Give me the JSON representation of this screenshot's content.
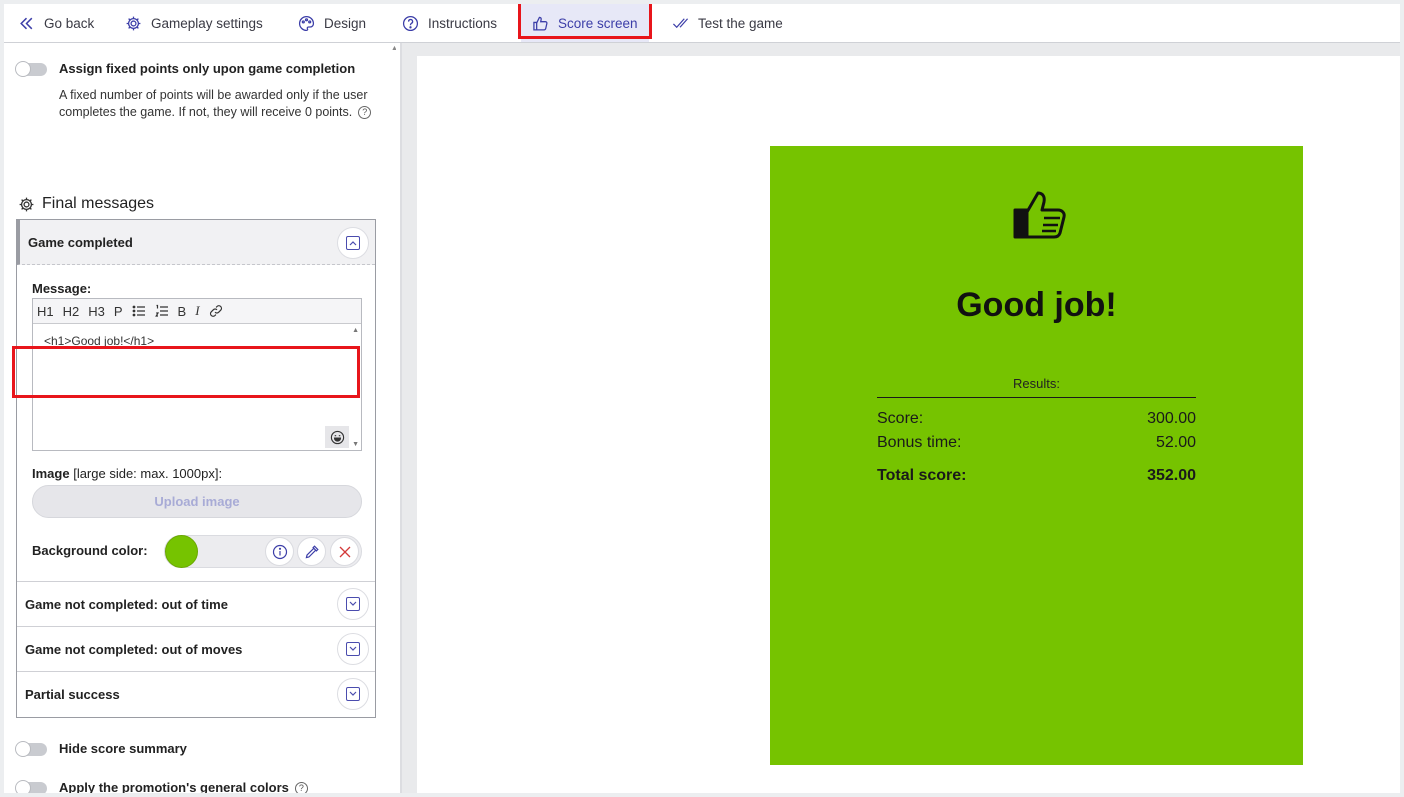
{
  "nav": {
    "go_back": "Go back",
    "gameplay_settings": "Gameplay settings",
    "design": "Design",
    "instructions": "Instructions",
    "score_screen": "Score screen",
    "test_game": "Test the game"
  },
  "left": {
    "fixed_points": {
      "label": "Assign fixed points only upon game completion",
      "description": "A fixed number of points will be awarded only if the user completes the game. If not, they will receive 0 points."
    },
    "final_messages_title": "Final messages",
    "game_completed": {
      "title": "Game completed",
      "message_label": "Message:",
      "toolbar": [
        "H1",
        "H2",
        "H3",
        "P",
        "B",
        "I"
      ],
      "message_value": "<h1>Good job!</h1>",
      "image_label": "Image",
      "image_hint": "[large side: max. 1000px]:",
      "upload_label": "Upload image",
      "bg_color_label": "Background color:",
      "bg_color_value": "#76c300"
    },
    "collapsed_sections": [
      "Game not completed: out of time",
      "Game not completed: out of moves",
      "Partial success"
    ],
    "hide_score_summary": "Hide score summary",
    "apply_colors": "Apply the promotion's general colors"
  },
  "preview": {
    "card_color": "#76c300",
    "title": "Good job!",
    "results_label": "Results:",
    "score_label": "Score:",
    "score_value": "300.00",
    "bonus_label": "Bonus time:",
    "bonus_value": "52.00",
    "total_label": "Total score:",
    "total_value": "352.00"
  },
  "colors": {
    "accent": "#3c3ea8",
    "highlight": "#e8151b",
    "card_green": "#76c300"
  }
}
